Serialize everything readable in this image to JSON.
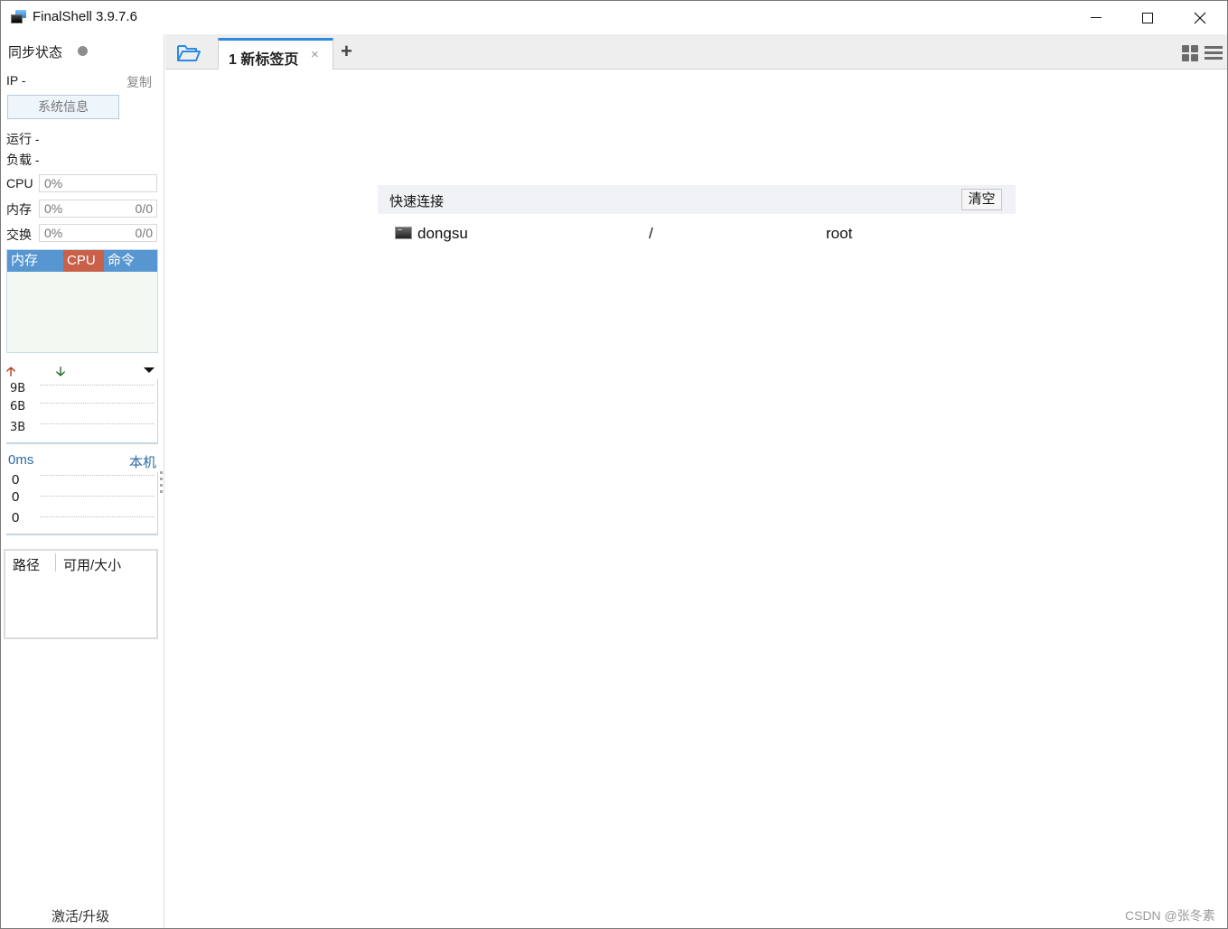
{
  "window": {
    "title": "FinalShell 3.9.7.6",
    "controls": {
      "minimize": "minimize",
      "maximize": "maximize",
      "close": "×"
    }
  },
  "sidebar": {
    "sync_label": "同步状态",
    "sync_status_color": "#8e8e8e",
    "ip_label": "IP  -",
    "copy_label": "复制",
    "sysinfo_button": "系统信息",
    "uptime_label": "运行 -",
    "load_label": "负载 -",
    "meters": [
      {
        "label": "CPU",
        "percent": "0%",
        "ratio": ""
      },
      {
        "label": "内存",
        "percent": "0%",
        "ratio": "0/0"
      },
      {
        "label": "交换",
        "percent": "0%",
        "ratio": "0/0"
      }
    ],
    "process_tabs": [
      {
        "label": "内存",
        "color": "#5796d0"
      },
      {
        "label": "CPU",
        "color": "#c9604a"
      },
      {
        "label": "命令",
        "color": "#5796d0"
      }
    ],
    "network": {
      "upload_icon": "arrow-up",
      "download_icon": "arrow-down",
      "axis_labels": [
        "9B",
        "6B",
        "3B"
      ]
    },
    "ping": {
      "latency": "0ms",
      "host": "本机",
      "values": [
        "0",
        "0",
        "0"
      ]
    },
    "disk": {
      "columns": [
        "路径",
        "可用/大小"
      ]
    },
    "activate_label": "激活/升级"
  },
  "tabs": {
    "items": [
      {
        "label": "1 新标签页",
        "active": true,
        "close": "×"
      }
    ],
    "add_label": "+"
  },
  "quick_connect": {
    "title": "快速连接",
    "clear_button": "清空",
    "rows": [
      {
        "name": "dongsu",
        "path": "/",
        "user": "root"
      }
    ]
  },
  "watermark": "CSDN @张冬素",
  "colors": {
    "accent": "#2d8ae0",
    "link": "#2c6ca5"
  }
}
